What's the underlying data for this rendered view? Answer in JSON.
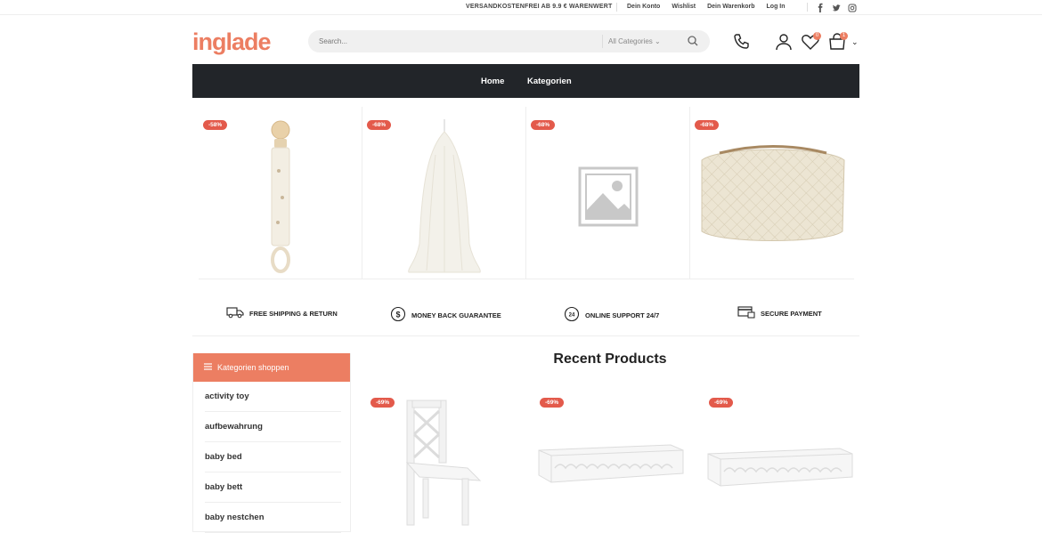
{
  "topbar": {
    "message": "VERSANDKOSTENFREI AB 9.9 € WARENWERT",
    "links": [
      "Dein Konto",
      "Wishlist",
      "Dein Warenkorb",
      "Log In"
    ],
    "social": [
      "facebook-icon",
      "twitter-icon",
      "instagram-icon"
    ]
  },
  "header": {
    "logo": "inglade",
    "search_placeholder": "Search...",
    "category_select": "All Categories",
    "wishlist_count": "0",
    "cart_count": "1"
  },
  "nav": {
    "items": [
      "Home",
      "Kategorien"
    ]
  },
  "featured_products": [
    {
      "badge": "-58%",
      "image": "pacifier-clip"
    },
    {
      "badge": "-68%",
      "image": "canopy"
    },
    {
      "badge": "-68%",
      "image": "placeholder-image"
    },
    {
      "badge": "-68%",
      "image": "quilted-bag"
    }
  ],
  "features": [
    {
      "icon": "truck-icon",
      "label": "FREE SHIPPING & RETURN"
    },
    {
      "icon": "money-icon",
      "label": "MONEY BACK GUARANTEE"
    },
    {
      "icon": "support-24-icon",
      "label": "ONLINE SUPPORT 24/7"
    },
    {
      "icon": "payment-icon",
      "label": "SECURE PAYMENT"
    }
  ],
  "sidebar": {
    "title": "Kategorien shoppen",
    "items": [
      "activity toy",
      "aufbewahrung",
      "baby bed",
      "baby bett",
      "baby nestchen"
    ]
  },
  "recent": {
    "title": "Recent Products",
    "products": [
      {
        "badge": "-69%",
        "image": "white-chair"
      },
      {
        "badge": "-69%",
        "image": "white-shelf"
      },
      {
        "badge": "-69%",
        "image": "white-shelf"
      }
    ]
  },
  "colors": {
    "accent": "#ec7e62",
    "sale": "#e35a4b",
    "nav_bg": "#222529"
  }
}
